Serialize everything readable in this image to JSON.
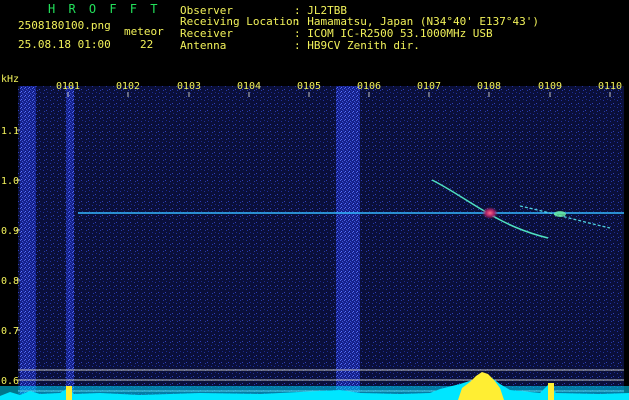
{
  "header": {
    "app_name": "H R O F F T",
    "filename": "2508180100.png",
    "datetime": "25.08.18 01:00",
    "mode_label": "meteor",
    "count": "22",
    "observer_label": "Observer",
    "observer_value": ": JL2TBB",
    "location_label": "Receiving Location",
    "location_value": ": Hamamatsu, Japan (N34°40' E137°43')",
    "receiver_label": "Receiver",
    "receiver_value": ": ICOM IC-R2500 53.1000MHz USB",
    "antenna_label": "Antenna",
    "antenna_value": ": HB9CV Zenith dir."
  },
  "axis": {
    "unit": "kHz",
    "y_ticks": [
      "1.1",
      "1.0",
      "0.9",
      "0.8",
      "0.7",
      "0.6"
    ],
    "x_ticks": [
      "0101",
      "0102",
      "0103",
      "0104",
      "0105",
      "0106",
      "0107",
      "0108",
      "0109",
      "0110"
    ]
  },
  "colors": {
    "background": "#000000",
    "spectrum_base": "#1b2a8c",
    "carrier": "#35b8ff",
    "trail": "#4fe0c0",
    "hotspot": "#ff5577",
    "signal": "#00e6ff",
    "bursts": "#ffee33",
    "label_green": "#22e05a",
    "label_yellow": "#f2f25a"
  }
}
